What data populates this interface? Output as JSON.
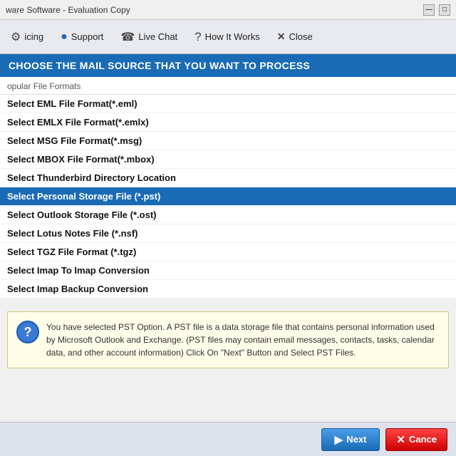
{
  "titleBar": {
    "title": "ware Software - Evaluation Copy",
    "minimizeLabel": "—",
    "maximizeLabel": "□"
  },
  "toolbar": {
    "buttons": [
      {
        "id": "licensing",
        "icon": "⚙",
        "label": "icing"
      },
      {
        "id": "support",
        "icon": "●",
        "label": "Support"
      },
      {
        "id": "live-chat",
        "icon": "📞",
        "label": "Live Chat"
      },
      {
        "id": "how-it-works",
        "icon": "❓",
        "label": "How It Works"
      },
      {
        "id": "close",
        "icon": "✕",
        "label": "Close"
      }
    ]
  },
  "headerBanner": {
    "text": "CHOOSE THE MAIL SOURCE THAT YOU WANT TO PROCESS"
  },
  "sectionLabel": "opular File Formats",
  "fileFormats": [
    {
      "id": "eml",
      "label": "Select EML File Format(*.eml)",
      "selected": false
    },
    {
      "id": "emlx",
      "label": "Select EMLX File Format(*.emlx)",
      "selected": false
    },
    {
      "id": "msg",
      "label": "Select MSG File Format(*.msg)",
      "selected": false
    },
    {
      "id": "mbox",
      "label": "Select MBOX File Format(*.mbox)",
      "selected": false
    },
    {
      "id": "thunderbird",
      "label": "Select Thunderbird Directory Location",
      "selected": false
    },
    {
      "id": "pst",
      "label": "Select Personal Storage File (*.pst)",
      "selected": true
    },
    {
      "id": "ost",
      "label": "Select Outlook Storage File (*.ost)",
      "selected": false
    },
    {
      "id": "nsf",
      "label": "Select Lotus Notes File (*.nsf)",
      "selected": false
    },
    {
      "id": "tgz",
      "label": "Select TGZ File Format (*.tgz)",
      "selected": false
    },
    {
      "id": "imap-convert",
      "label": "Select Imap To Imap Conversion",
      "selected": false
    },
    {
      "id": "imap-backup",
      "label": "Select Imap Backup Conversion",
      "selected": false
    }
  ],
  "infoBox": {
    "text": "You have selected PST Option. A PST file is a data storage file that contains personal information used by Microsoft Outlook and Exchange. (PST files may contain email messages, contacts, tasks, calendar data, and other account information) Click On \"Next\" Button and Select PST Files.",
    "icon": "?"
  },
  "bottomBar": {
    "nextLabel": "Next",
    "cancelLabel": "Cance"
  }
}
